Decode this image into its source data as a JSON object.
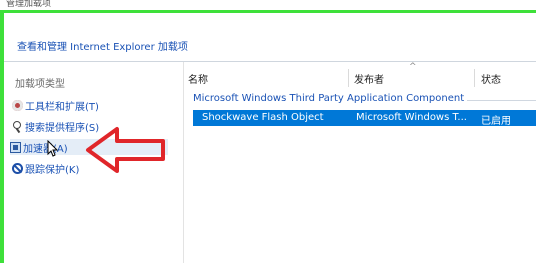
{
  "window": {
    "title": "管理加载项"
  },
  "header": {
    "link_text": "查看和管理 Internet Explorer 加载项"
  },
  "sidebar": {
    "title": "加载项类型",
    "items": [
      {
        "label": "工具栏和扩展(T)",
        "icon": "gear-icon"
      },
      {
        "label": "搜索提供程序(S)",
        "icon": "search-icon"
      },
      {
        "label": "加速器(A)",
        "icon": "accelerator-icon"
      },
      {
        "label": "跟踪保护(K)",
        "icon": "tracking-protection-icon"
      }
    ],
    "selected_index": 2
  },
  "list": {
    "columns": [
      "名称",
      "发布者",
      "状态"
    ],
    "group": "Microsoft Windows Third Party Application Component",
    "rows": [
      {
        "name": "Shockwave Flash Object",
        "publisher": "Microsoft Windows T...",
        "status": "已启用"
      }
    ]
  },
  "colors": {
    "frame_accent": "#3ee03a",
    "selection": "#0078d7",
    "link": "#1a52b5",
    "annotation_arrow": "#e0262a"
  }
}
